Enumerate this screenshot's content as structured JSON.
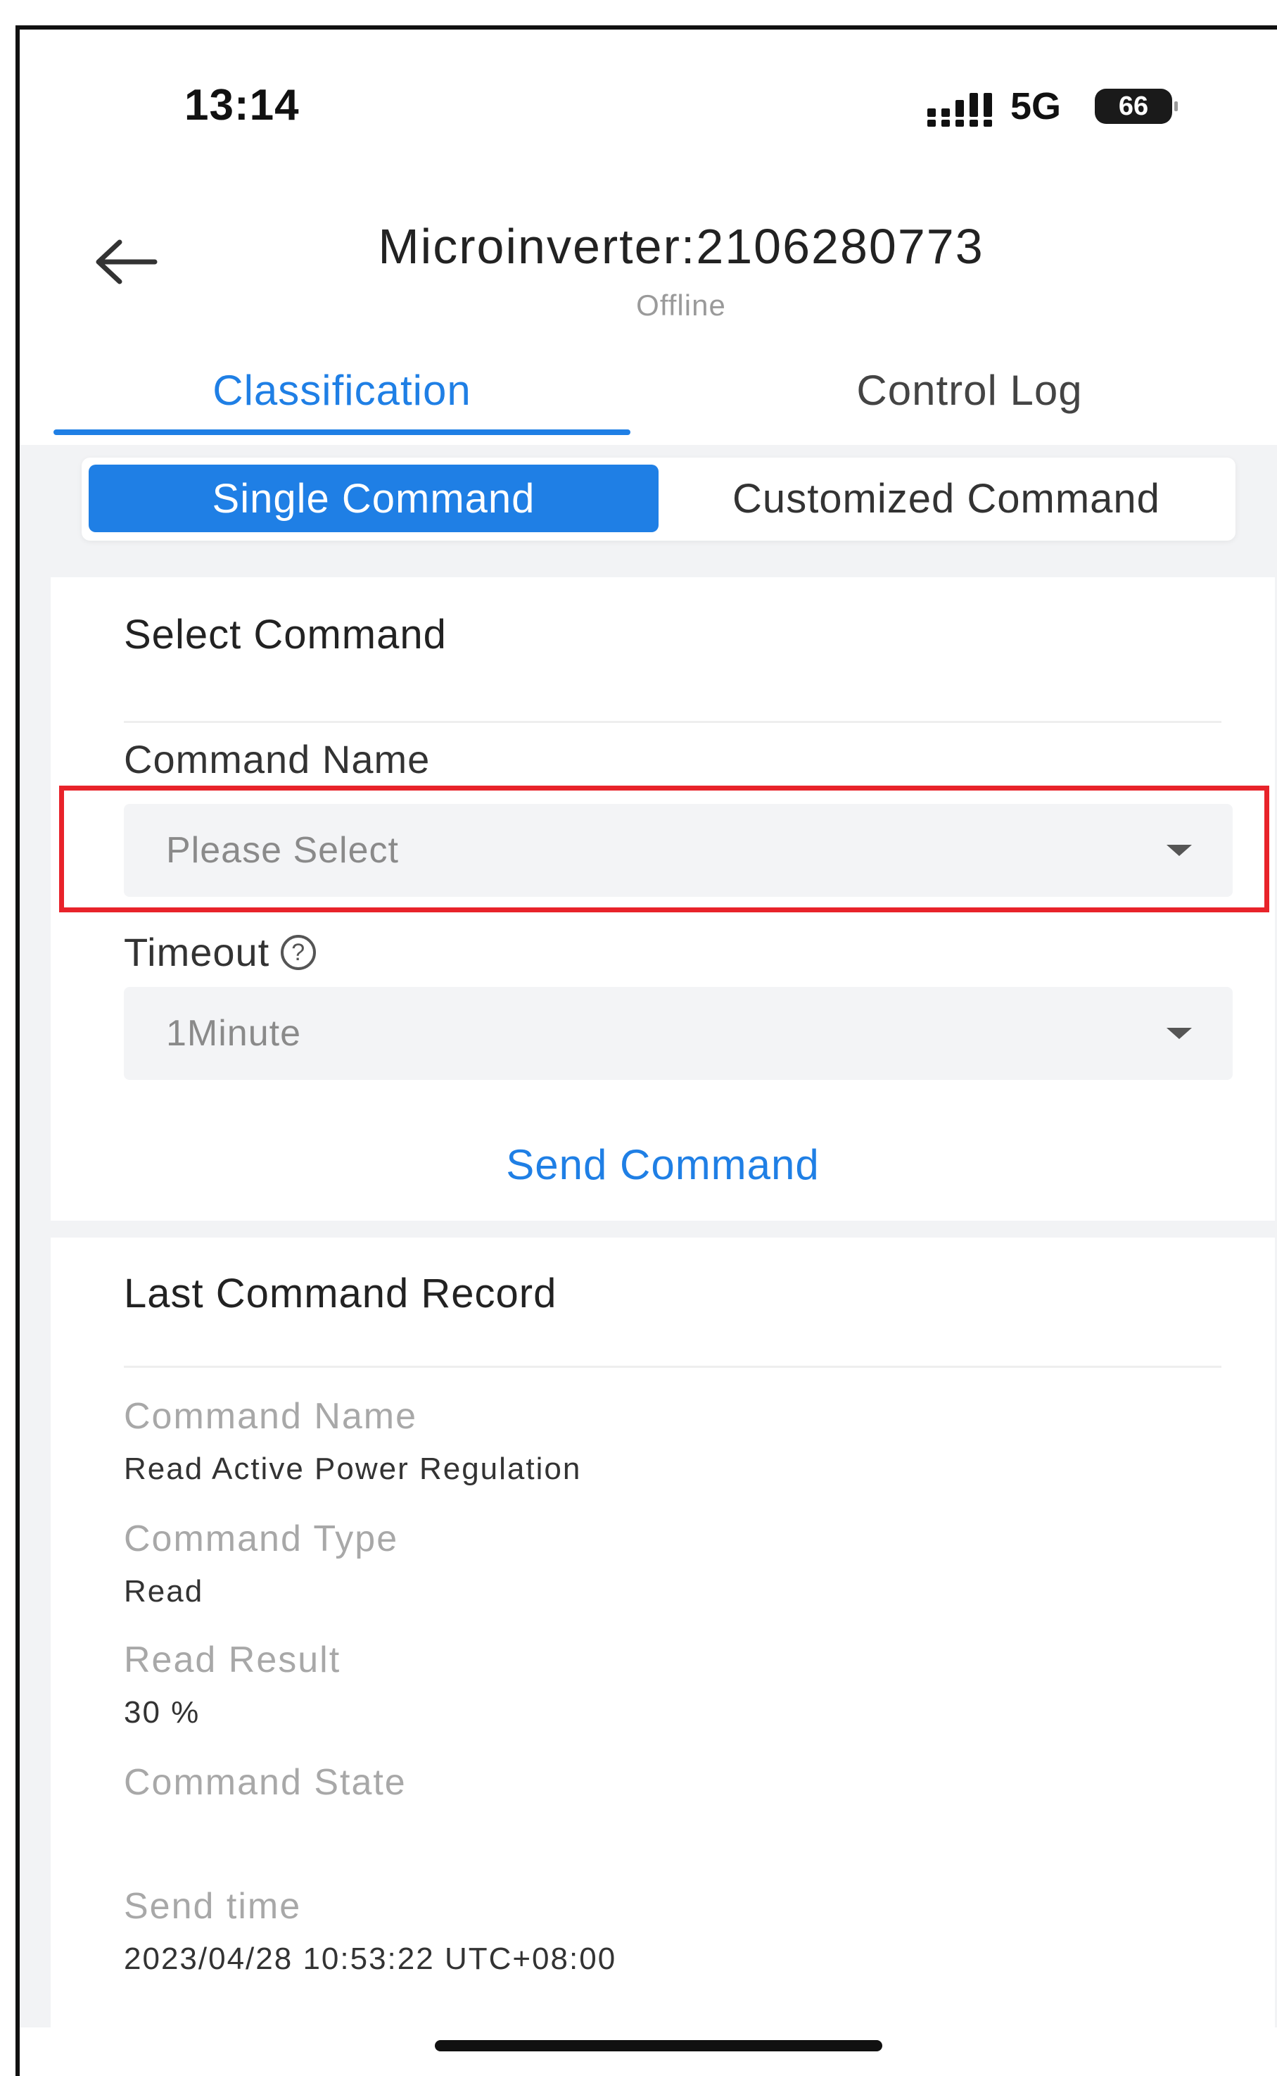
{
  "status_bar": {
    "time": "13:14",
    "network": "5G",
    "battery": "66"
  },
  "header": {
    "title": "Microinverter:2106280773",
    "subtitle": "Offline"
  },
  "tabs": [
    {
      "label": "Classification",
      "active": true
    },
    {
      "label": "Control Log",
      "active": false
    }
  ],
  "segment": {
    "options": [
      "Single Command",
      "Customized Command"
    ],
    "selected": "Single Command"
  },
  "select_command": {
    "title": "Select Command",
    "command_name_label": "Command Name",
    "command_name_placeholder": "Please Select",
    "timeout_label": "Timeout",
    "timeout_value": "1Minute",
    "send_label": "Send Command"
  },
  "last_record": {
    "title": "Last Command Record",
    "fields": [
      {
        "label": "Command Name",
        "value": "Read Active Power Regulation"
      },
      {
        "label": "Command Type",
        "value": "Read"
      },
      {
        "label": "Read Result",
        "value": "30 %"
      },
      {
        "label": "Command State",
        "value": ""
      },
      {
        "label": "Send time",
        "value": "2023/04/28 10:53:22 UTC+08:00"
      }
    ]
  },
  "colors": {
    "accent": "#1f7fe5",
    "highlight": "#e8232a",
    "background": "#f2f3f5"
  }
}
